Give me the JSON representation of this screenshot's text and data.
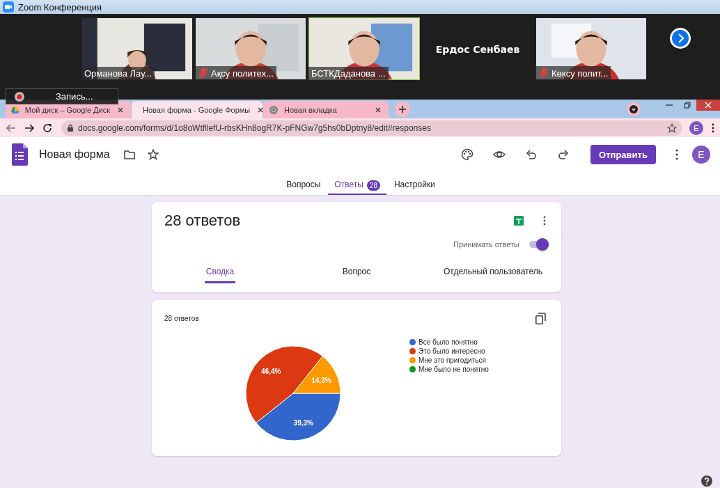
{
  "zoom_window": {
    "title": "Zoom Конференция",
    "participants": [
      {
        "kind": "video",
        "name": "Орманова Лау...",
        "muted": false,
        "active": false
      },
      {
        "kind": "video",
        "name": "Ақсу политех...",
        "muted": true,
        "active": false
      },
      {
        "kind": "video",
        "name": "БСТКДаданова ...",
        "muted": false,
        "active": true
      },
      {
        "kind": "name",
        "name": "Ердос Сенбаев",
        "muted": false,
        "active": false
      },
      {
        "kind": "video",
        "name": "Көксу полит...",
        "muted": true,
        "active": false
      }
    ],
    "recording": {
      "label": "Запись..."
    }
  },
  "browser": {
    "tabs": [
      {
        "title": "Мой диск – Google Диск",
        "selected": false,
        "kind": "drive"
      },
      {
        "title": "Новая форма - Google Формы",
        "selected": true,
        "kind": "forms"
      },
      {
        "title": "Новая вкладка",
        "selected": false,
        "kind": "chrome"
      }
    ],
    "url": "docs.google.com/forms/d/1o8oWtfllefU-rbsKHn8ogR7K-pFNGw7g5hs0bDptny8/edit#responses",
    "profile": "E"
  },
  "form": {
    "title": "Новая форма",
    "send_button": "Отправить",
    "avatar": "E",
    "tabs": [
      {
        "label": "Вопросы",
        "selected": false
      },
      {
        "label": "Ответы",
        "badge": "28",
        "selected": true
      },
      {
        "label": "Настройки",
        "selected": false
      }
    ]
  },
  "responses": {
    "title": "28 ответов",
    "accepting_label": "Принимать ответы",
    "accepting": true,
    "views": [
      {
        "label": "Сводка",
        "selected": true
      },
      {
        "label": "Вопрос",
        "selected": false
      },
      {
        "label": "Отдельный пользователь",
        "selected": false
      }
    ]
  },
  "question": {
    "count": "28 ответов",
    "chart_data": {
      "type": "pie",
      "categories": [
        "Все было понятно",
        "Это было интересно",
        "Мне это пригодиться",
        "Мне было не понятно"
      ],
      "values": [
        39.3,
        46.4,
        14.3,
        0
      ],
      "value_labels": [
        "39,3%",
        "46,4%",
        "14,3%",
        null
      ]
    }
  }
}
